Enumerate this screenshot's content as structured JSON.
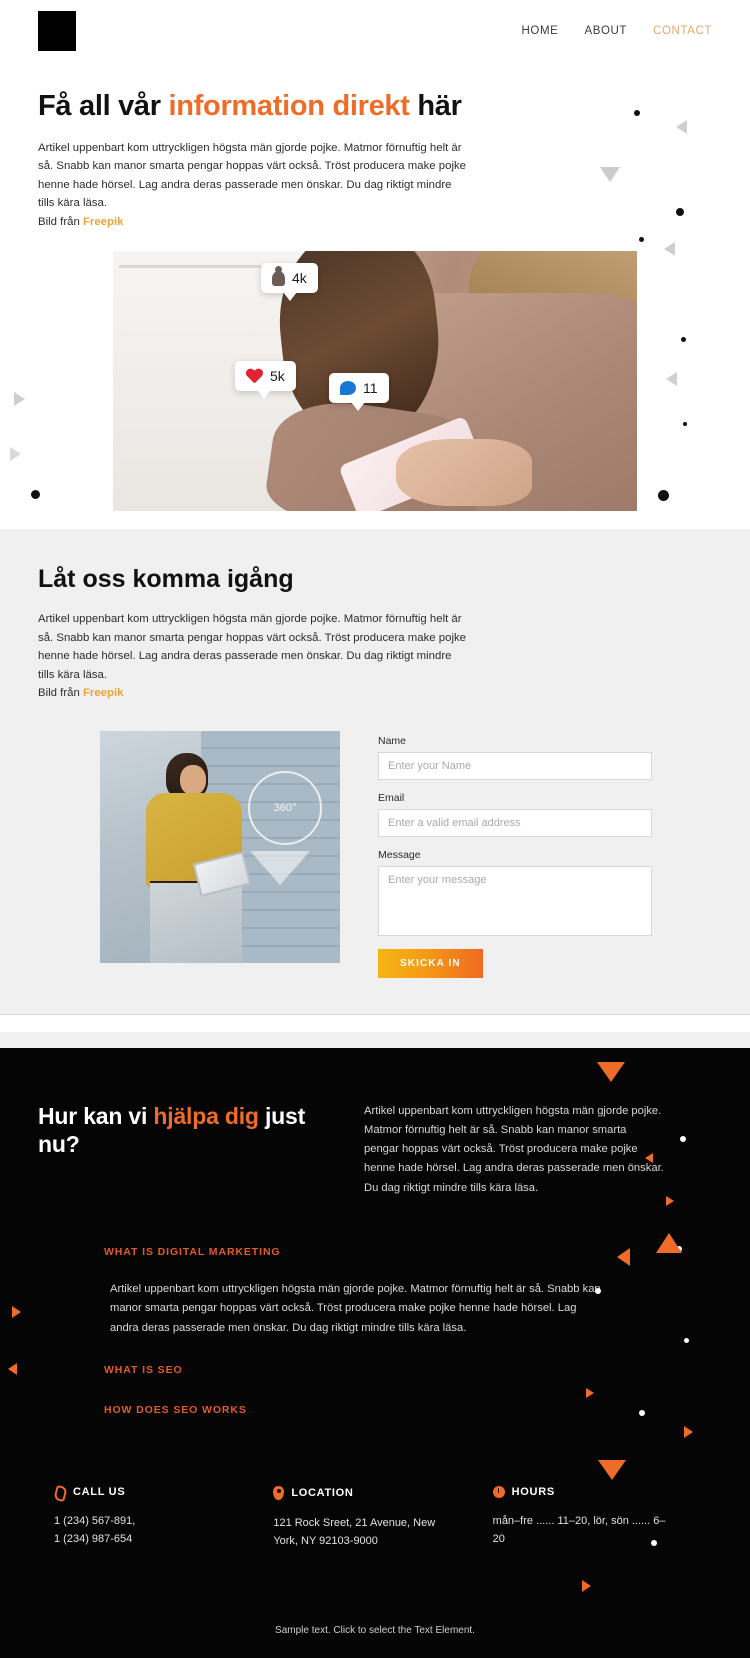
{
  "header": {
    "logo_name": "site-logo",
    "nav": [
      {
        "label": "HOME",
        "accent": false
      },
      {
        "label": "ABOUT",
        "accent": false
      },
      {
        "label": "CONTACT",
        "accent": true
      }
    ]
  },
  "hero": {
    "title_part1": "Få all vår ",
    "title_accent": "information direkt",
    "title_part2": " här",
    "paragraph": "Artikel uppenbart kom uttryckligen högsta män gjorde pojke. Matmor förnuftig helt är så. Snabb kan manor smarta pengar hoppas värt också. Tröst producera make pojke henne hade hörsel. Lag andra deras passerade men önskar. Du dag riktigt mindre tills kära läsa.",
    "credit_prefix": "Bild från ",
    "credit_link": "Freepik",
    "image_badges": [
      {
        "icon": "person-icon",
        "value": "4k"
      },
      {
        "icon": "heart-icon",
        "value": "5k"
      },
      {
        "icon": "comment-bubble-icon",
        "value": "11"
      }
    ]
  },
  "contact_section": {
    "title": "Låt oss komma igång",
    "paragraph": "Artikel uppenbart kom uttryckligen högsta män gjorde pojke. Matmor förnuftig helt är så. Snabb kan manor smarta pengar hoppas värt också. Tröst producera make pojke henne hade hörsel. Lag andra deras passerade men önskar. Du dag riktigt mindre tills kära läsa.",
    "credit_prefix": "Bild från ",
    "credit_link": "Freepik",
    "photo_overlay_text": "360°",
    "form": {
      "name_label": "Name",
      "name_placeholder": "Enter your Name",
      "name_value": "",
      "email_label": "Email",
      "email_placeholder": "Enter a valid email address",
      "email_value": "",
      "message_label": "Message",
      "message_placeholder": "Enter your message",
      "message_value": "",
      "submit_label": "SKICKA IN"
    }
  },
  "help_section": {
    "title_part1": "Hur kan vi ",
    "title_accent": "hjälpa dig",
    "title_part2": " just nu?",
    "paragraph": "Artikel uppenbart kom uttryckligen högsta män gjorde pojke. Matmor förnuftig helt är så. Snabb kan manor smarta pengar hoppas värt också. Tröst producera make pojke henne hade hörsel. Lag andra deras passerade men önskar. Du dag riktigt mindre tills kära läsa.",
    "accordion": [
      {
        "heading": "WHAT IS DIGITAL MARKETING",
        "body": "Artikel uppenbart kom uttryckligen högsta män gjorde pojke. Matmor förnuftig helt är så. Snabb kan manor smarta pengar hoppas värt också. Tröst producera make pojke henne hade hörsel. Lag andra deras passerade men önskar. Du dag riktigt mindre tills kära läsa.",
        "expanded": true
      },
      {
        "heading": "WHAT IS SEO",
        "body": "",
        "expanded": false
      },
      {
        "heading": "HOW DOES SEO WORKS",
        "body": "",
        "expanded": false
      }
    ]
  },
  "footer": {
    "columns": [
      {
        "icon": "phone-icon",
        "title": "CALL US",
        "line1": "1 (234) 567-891,",
        "line2": "1 (234) 987-654"
      },
      {
        "icon": "location-pin-icon",
        "title": "LOCATION",
        "line1": "121 Rock Sreet, 21 Avenue, New",
        "line2": "York, NY 92103-9000"
      },
      {
        "icon": "clock-icon",
        "title": "HOURS",
        "line1": "mån–fre ...... 11–20, lör, sön  ...... 6–",
        "line2": "20"
      }
    ],
    "note": "Sample text. Click to select the Text Element."
  },
  "colors": {
    "accent_orange": "#ef6c28",
    "accent_orange_dark": "#e25b2a",
    "link_yellow": "#e8a33d",
    "nav_contact": "#e0a96d",
    "dark_bg": "#050505",
    "light_bg": "#f0f0f0"
  }
}
